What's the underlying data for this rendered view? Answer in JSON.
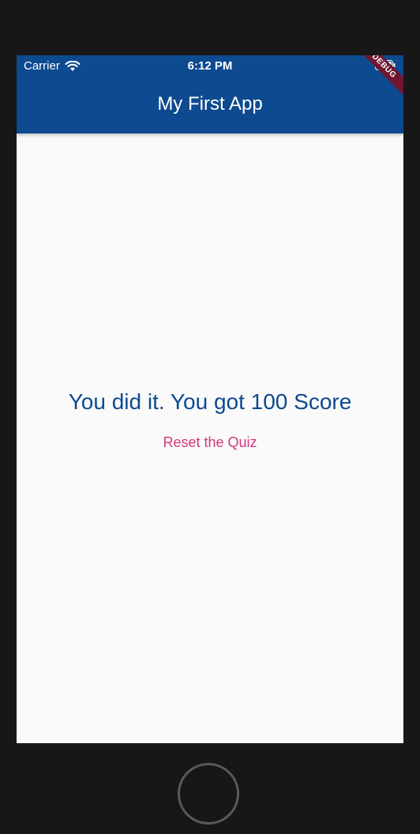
{
  "status_bar": {
    "carrier": "Carrier",
    "time": "6:12 PM",
    "wifi_icon": "wifi-icon",
    "battery_icon": "battery-icon"
  },
  "app_bar": {
    "title": "My First App",
    "debug_label": "DEBUG",
    "background_color": "#0d4a8f"
  },
  "main": {
    "result_text": "You did it. You got 100 Score",
    "reset_label": "Reset the Quiz",
    "result_color": "#0d4a8f",
    "reset_color": "#d6367f"
  },
  "device": {
    "home_button_icon": "home-button"
  }
}
